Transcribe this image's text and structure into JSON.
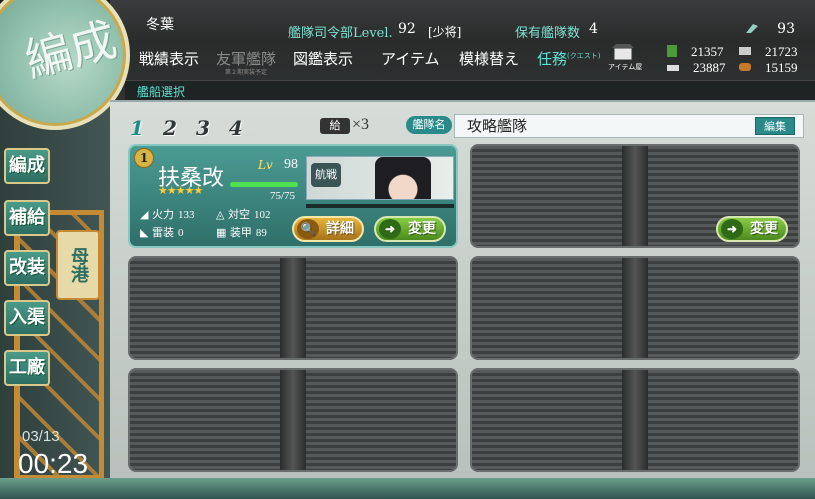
{
  "header": {
    "hq_name": "冬葉",
    "hq_level_label": "艦隊司令部Level.",
    "hq_level": "92",
    "rank": "[少将]",
    "fleet_count_label": "保有艦隊数",
    "fleet_count": "4",
    "dev_materials": "93"
  },
  "nav": {
    "record": "戦績表示",
    "friend_fleet": "友軍艦隊",
    "friend_fleet_note": "第２期実装予定",
    "encyclopedia": "図鑑表示",
    "items": "アイテム",
    "furniture": "模様替え",
    "quest": "任務",
    "quest_sup": "(クエスト)",
    "item_shop": "アイテム屋"
  },
  "resources": {
    "fuel": "21357",
    "ammo": "21723",
    "steel": "23887",
    "bauxite": "15159"
  },
  "subbar_title": "艦船選択",
  "fleet": {
    "tabs": [
      "1",
      "2",
      "3",
      "4"
    ],
    "active_tab": 0,
    "supply_icon": "給",
    "supply_count": "×3",
    "name_label": "艦隊名",
    "name": "攻略艦隊",
    "edit": "編集"
  },
  "ship": {
    "badge": "1",
    "name": "扶桑改",
    "lv_label": "Lv",
    "lv": "98",
    "stars": "★★★★★",
    "hp": "75/75",
    "hp_fraction": 1.0,
    "type_label": "航戦",
    "firepower_label": "火力",
    "firepower": "133",
    "aa_label": "対空",
    "aa": "102",
    "torpedo_label": "雷装",
    "torpedo": "0",
    "armor_label": "装甲",
    "armor": "89",
    "detail_btn": "詳細",
    "change_btn": "変更"
  },
  "empty_slot_change_btn": "変更",
  "side_menu": {
    "organize": "編成",
    "supply": "補給",
    "remodel": "改装",
    "dock": "入渠",
    "arsenal": "工廠",
    "port": "母港"
  },
  "logo_text": "編成",
  "date": "03/13",
  "time": "00:23"
}
